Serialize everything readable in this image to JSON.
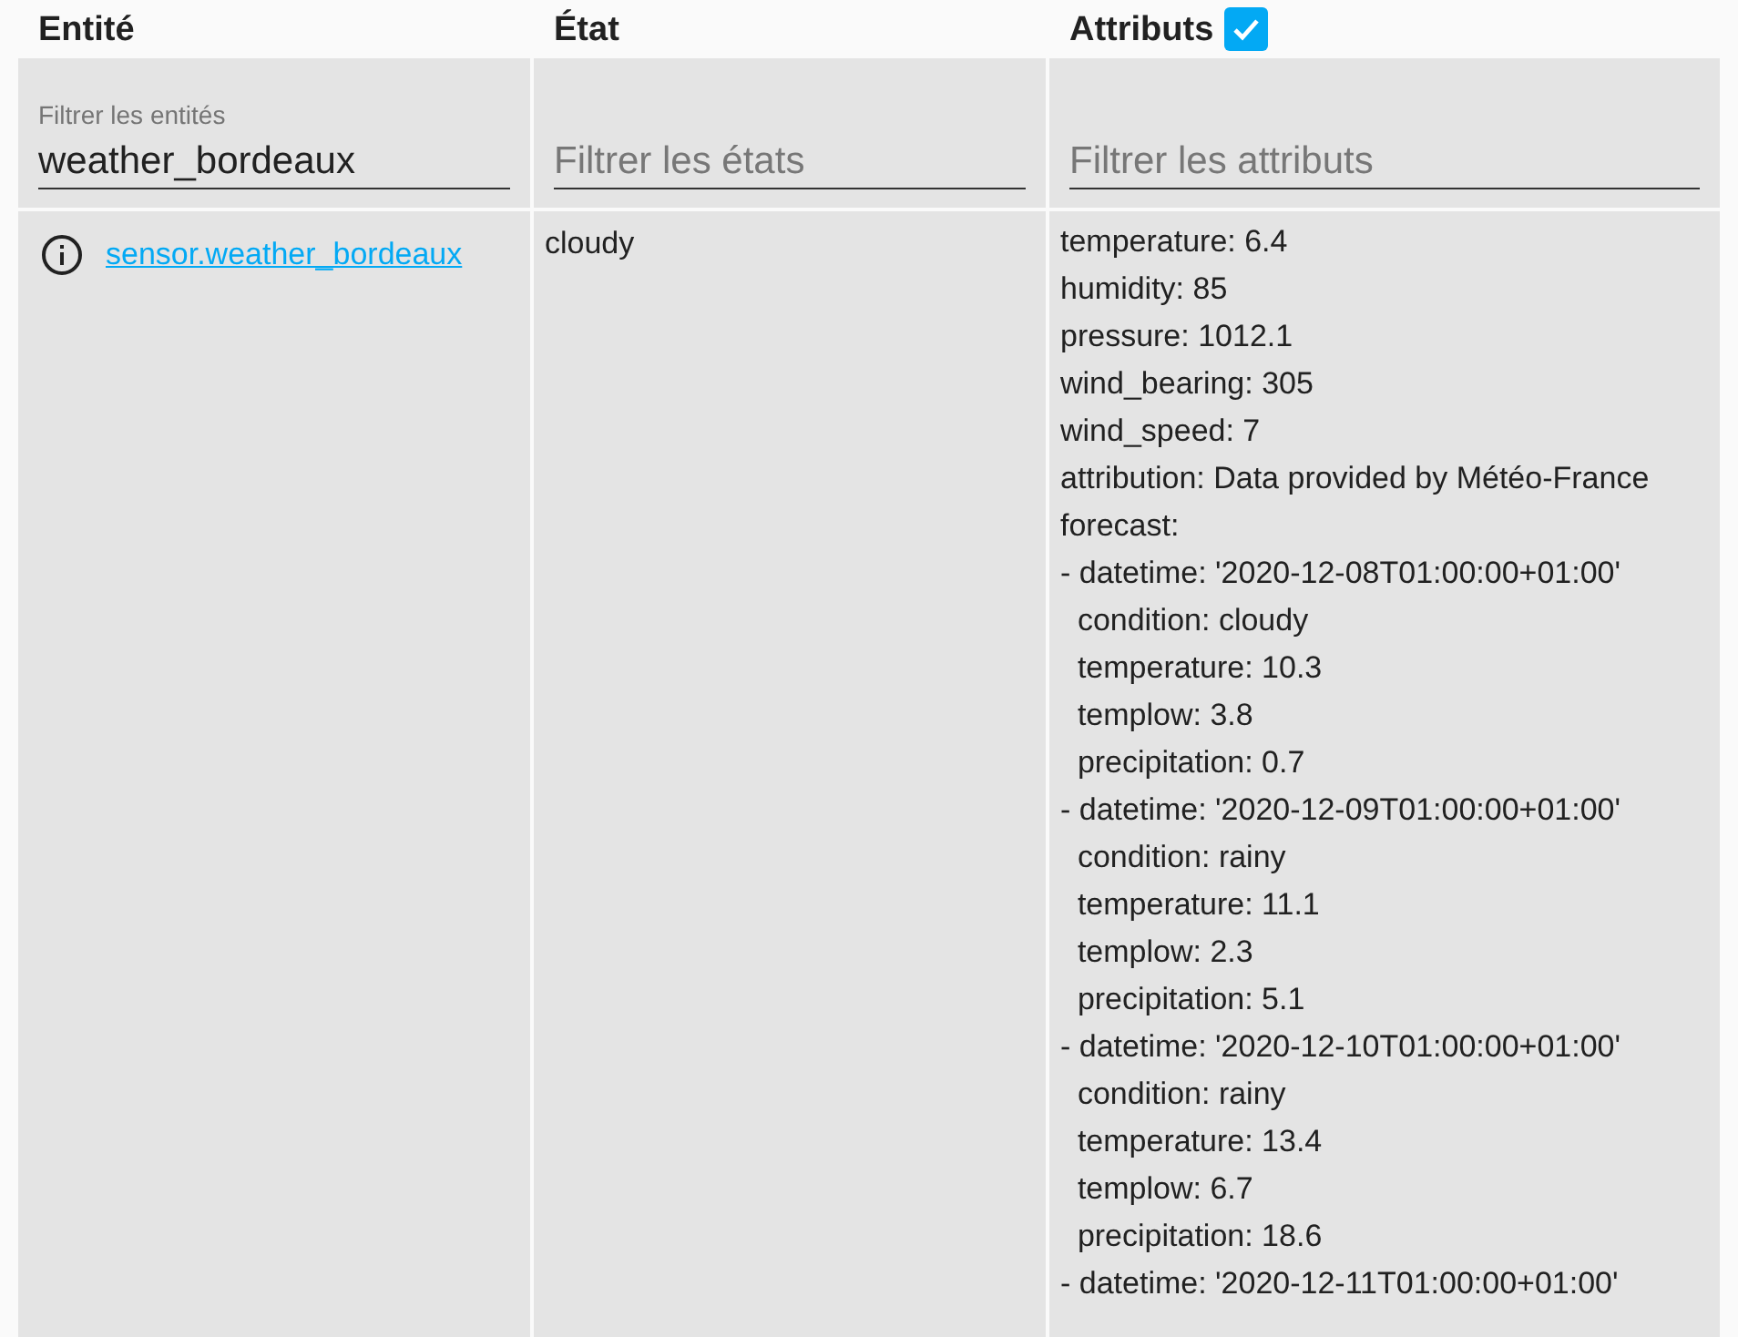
{
  "columns": [
    {
      "title": "Entité"
    },
    {
      "title": "État"
    },
    {
      "title": "Attributs",
      "checkbox": {
        "checked": true
      }
    }
  ],
  "filters": [
    {
      "label": "Filtrer les entités",
      "value": "weather_bordeaux"
    },
    {
      "placeholder": "Filtrer les états"
    },
    {
      "placeholder": "Filtrer les attributs"
    }
  ],
  "rows": [
    {
      "entity": "sensor.weather_bordeaux",
      "state": "cloudy",
      "attributes": [
        "temperature: 6.4",
        "humidity: 85",
        "pressure: 1012.1",
        "wind_bearing: 305",
        "wind_speed: 7",
        "attribution: Data provided by Météo-France",
        "forecast:",
        "- datetime: '2020-12-08T01:00:00+01:00'",
        "  condition: cloudy",
        "  temperature: 10.3",
        "  templow: 3.8",
        "  precipitation: 0.7",
        "- datetime: '2020-12-09T01:00:00+01:00'",
        "  condition: rainy",
        "  temperature: 11.1",
        "  templow: 2.3",
        "  precipitation: 5.1",
        "- datetime: '2020-12-10T01:00:00+01:00'",
        "  condition: rainy",
        "  temperature: 13.4",
        "  templow: 6.7",
        "  precipitation: 18.6",
        "- datetime: '2020-12-11T01:00:00+01:00'"
      ]
    }
  ]
}
